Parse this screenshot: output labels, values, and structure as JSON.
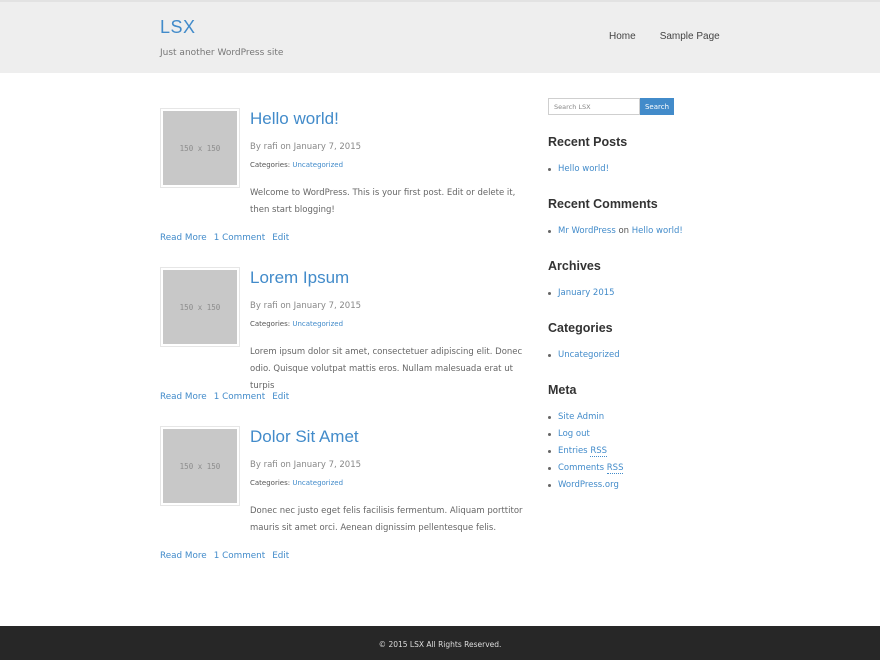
{
  "site": {
    "title": "LSX",
    "tagline": "Just another WordPress site"
  },
  "nav": {
    "items": [
      "Home",
      "Sample Page"
    ]
  },
  "posts": [
    {
      "thumb_label": "150 x 150",
      "title": "Hello world!",
      "meta_by": "By",
      "author": "rafi",
      "meta_on": "on",
      "date": "January 7, 2015",
      "categories_label": "Categories:",
      "category": "Uncategorized",
      "excerpt": "Welcome to WordPress. This is your first post. Edit or delete it, then start blogging!",
      "read_more": "Read More",
      "comments": "1 Comment",
      "edit": "Edit"
    },
    {
      "thumb_label": "150 x 150",
      "title": "Lorem Ipsum",
      "meta_by": "By",
      "author": "rafi",
      "meta_on": "on",
      "date": "January 7, 2015",
      "categories_label": "Categories:",
      "category": "Uncategorized",
      "excerpt": "Lorem ipsum dolor sit amet, consectetuer adipiscing elit. Donec odio. Quisque volutpat mattis eros. Nullam malesuada erat ut turpis",
      "read_more": "Read More",
      "comments": "1 Comment",
      "edit": "Edit"
    },
    {
      "thumb_label": "150 x 150",
      "title": "Dolor Sit Amet",
      "meta_by": "By",
      "author": "rafi",
      "meta_on": "on",
      "date": "January 7, 2015",
      "categories_label": "Categories:",
      "category": "Uncategorized",
      "excerpt": "Donec nec justo eget felis facilisis fermentum. Aliquam porttitor mauris sit amet orci. Aenean dignissim pellentesque felis.",
      "read_more": "Read More",
      "comments": "1 Comment",
      "edit": "Edit"
    }
  ],
  "sidebar": {
    "search": {
      "placeholder": "Search LSX",
      "button": "Search"
    },
    "recent_posts": {
      "title": "Recent Posts",
      "items": [
        "Hello world!"
      ]
    },
    "recent_comments": {
      "title": "Recent Comments",
      "author": "Mr WordPress",
      "on": "on",
      "post": "Hello world!"
    },
    "archives": {
      "title": "Archives",
      "items": [
        "January 2015"
      ]
    },
    "categories": {
      "title": "Categories",
      "items": [
        "Uncategorized"
      ]
    },
    "meta": {
      "title": "Meta",
      "site_admin": "Site Admin",
      "log_out": "Log out",
      "entries_label": "Entries",
      "comments_label": "Comments",
      "rss": "RSS",
      "wordpress_org": "WordPress.org"
    }
  },
  "footer": {
    "text": "© 2015 LSX All Rights Reserved."
  },
  "colors": {
    "accent": "#428bca",
    "header_bg": "#eeeeee",
    "footer_bg": "#272727"
  }
}
